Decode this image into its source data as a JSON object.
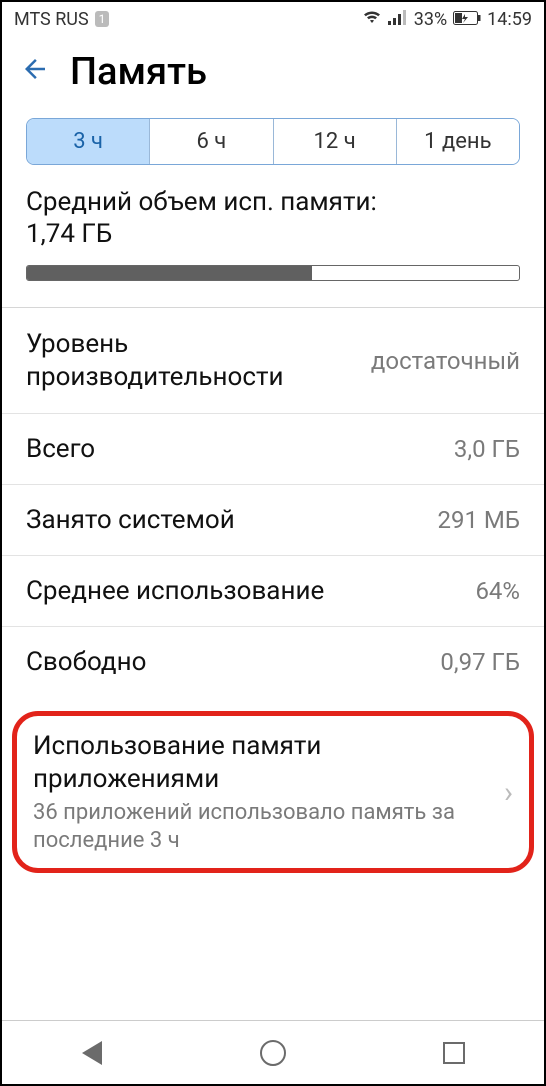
{
  "status": {
    "carrier": "MTS RUS",
    "sim": "1",
    "battery_pct": "33%",
    "time": "14:59"
  },
  "header": {
    "title": "Память"
  },
  "segments": {
    "items": [
      "3 ч",
      "6 ч",
      "12 ч",
      "1 день"
    ],
    "active_index": 0
  },
  "usage": {
    "label": "Средний объем исп. памяти:",
    "value": "1,74 ГБ",
    "fill_pct": 58
  },
  "rows": {
    "perf": {
      "label": "Уровень производительности",
      "value": "достаточный"
    },
    "total": {
      "label": "Всего",
      "value": "3,0 ГБ"
    },
    "system": {
      "label": "Занято системой",
      "value": "291 МБ"
    },
    "avg": {
      "label": "Среднее использование",
      "value": "64%"
    },
    "free": {
      "label": "Свободно",
      "value": "0,97 ГБ"
    }
  },
  "highlight": {
    "title": "Использование памяти приложениями",
    "subtitle": "36 приложений использовало память за последние 3 ч"
  }
}
